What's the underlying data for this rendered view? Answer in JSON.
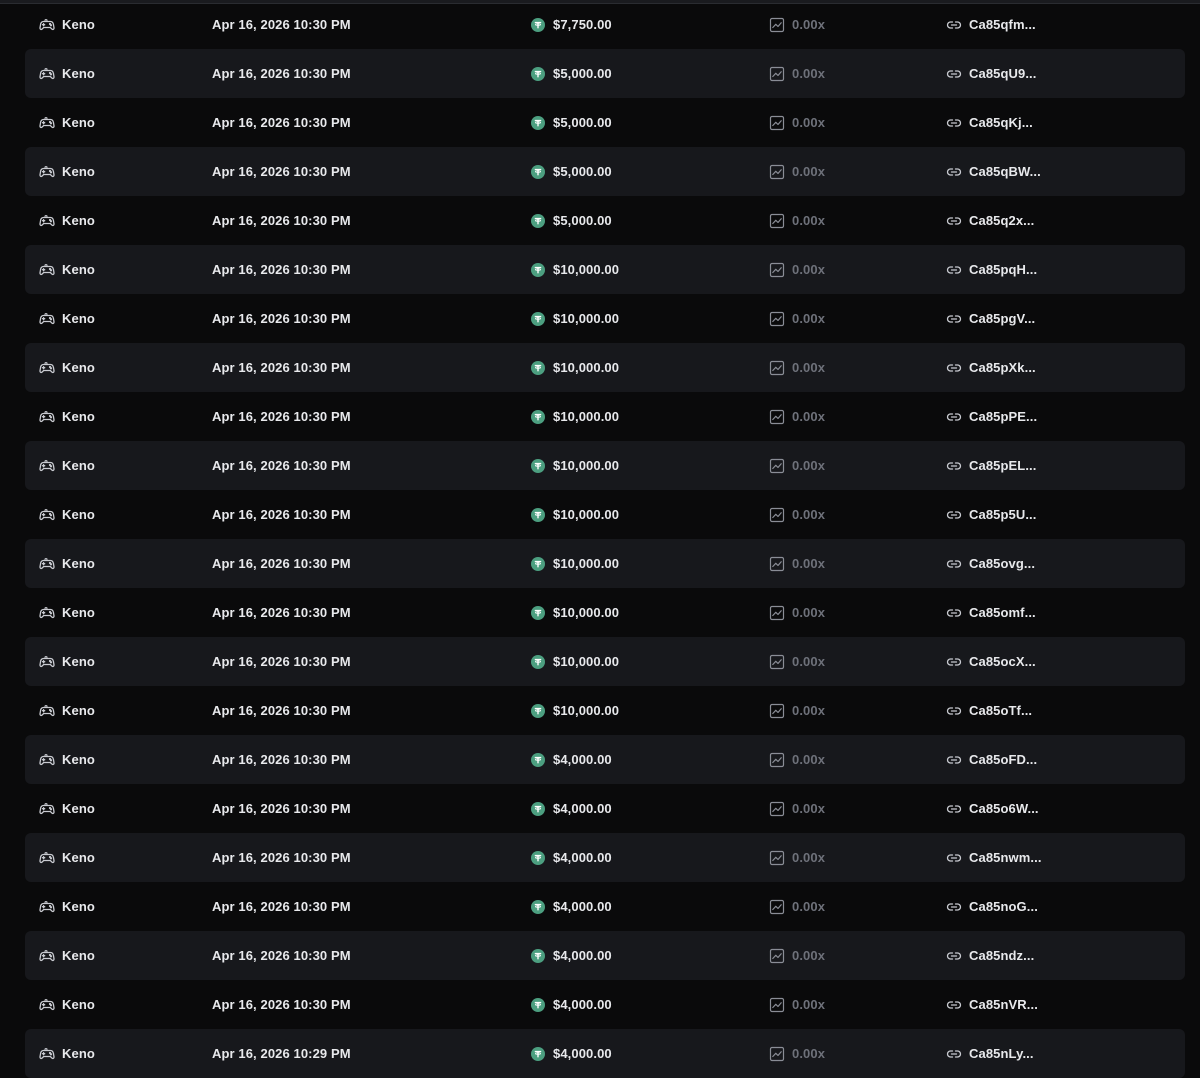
{
  "icons": {
    "game": "gamepad-icon",
    "currency": "tether-icon",
    "multiplier": "chart-icon",
    "tx": "link-icon"
  },
  "colors": {
    "background": "#0a0a0b",
    "row_alt": "#17181c",
    "tether": "#4c9f80",
    "muted": "#6e717a"
  },
  "rows": [
    {
      "game": "Keno",
      "date": "Apr 16, 2026 10:30 PM",
      "amount": "$7,750.00",
      "multiplier": "0.00x",
      "tx": "Ca85qfm..."
    },
    {
      "game": "Keno",
      "date": "Apr 16, 2026 10:30 PM",
      "amount": "$5,000.00",
      "multiplier": "0.00x",
      "tx": "Ca85qU9..."
    },
    {
      "game": "Keno",
      "date": "Apr 16, 2026 10:30 PM",
      "amount": "$5,000.00",
      "multiplier": "0.00x",
      "tx": "Ca85qKj..."
    },
    {
      "game": "Keno",
      "date": "Apr 16, 2026 10:30 PM",
      "amount": "$5,000.00",
      "multiplier": "0.00x",
      "tx": "Ca85qBW..."
    },
    {
      "game": "Keno",
      "date": "Apr 16, 2026 10:30 PM",
      "amount": "$5,000.00",
      "multiplier": "0.00x",
      "tx": "Ca85q2x..."
    },
    {
      "game": "Keno",
      "date": "Apr 16, 2026 10:30 PM",
      "amount": "$10,000.00",
      "multiplier": "0.00x",
      "tx": "Ca85pqH..."
    },
    {
      "game": "Keno",
      "date": "Apr 16, 2026 10:30 PM",
      "amount": "$10,000.00",
      "multiplier": "0.00x",
      "tx": "Ca85pgV..."
    },
    {
      "game": "Keno",
      "date": "Apr 16, 2026 10:30 PM",
      "amount": "$10,000.00",
      "multiplier": "0.00x",
      "tx": "Ca85pXk..."
    },
    {
      "game": "Keno",
      "date": "Apr 16, 2026 10:30 PM",
      "amount": "$10,000.00",
      "multiplier": "0.00x",
      "tx": "Ca85pPE..."
    },
    {
      "game": "Keno",
      "date": "Apr 16, 2026 10:30 PM",
      "amount": "$10,000.00",
      "multiplier": "0.00x",
      "tx": "Ca85pEL..."
    },
    {
      "game": "Keno",
      "date": "Apr 16, 2026 10:30 PM",
      "amount": "$10,000.00",
      "multiplier": "0.00x",
      "tx": "Ca85p5U..."
    },
    {
      "game": "Keno",
      "date": "Apr 16, 2026 10:30 PM",
      "amount": "$10,000.00",
      "multiplier": "0.00x",
      "tx": "Ca85ovg..."
    },
    {
      "game": "Keno",
      "date": "Apr 16, 2026 10:30 PM",
      "amount": "$10,000.00",
      "multiplier": "0.00x",
      "tx": "Ca85omf..."
    },
    {
      "game": "Keno",
      "date": "Apr 16, 2026 10:30 PM",
      "amount": "$10,000.00",
      "multiplier": "0.00x",
      "tx": "Ca85ocX..."
    },
    {
      "game": "Keno",
      "date": "Apr 16, 2026 10:30 PM",
      "amount": "$10,000.00",
      "multiplier": "0.00x",
      "tx": "Ca85oTf..."
    },
    {
      "game": "Keno",
      "date": "Apr 16, 2026 10:30 PM",
      "amount": "$4,000.00",
      "multiplier": "0.00x",
      "tx": "Ca85oFD..."
    },
    {
      "game": "Keno",
      "date": "Apr 16, 2026 10:30 PM",
      "amount": "$4,000.00",
      "multiplier": "0.00x",
      "tx": "Ca85o6W..."
    },
    {
      "game": "Keno",
      "date": "Apr 16, 2026 10:30 PM",
      "amount": "$4,000.00",
      "multiplier": "0.00x",
      "tx": "Ca85nwm..."
    },
    {
      "game": "Keno",
      "date": "Apr 16, 2026 10:30 PM",
      "amount": "$4,000.00",
      "multiplier": "0.00x",
      "tx": "Ca85noG..."
    },
    {
      "game": "Keno",
      "date": "Apr 16, 2026 10:30 PM",
      "amount": "$4,000.00",
      "multiplier": "0.00x",
      "tx": "Ca85ndz..."
    },
    {
      "game": "Keno",
      "date": "Apr 16, 2026 10:30 PM",
      "amount": "$4,000.00",
      "multiplier": "0.00x",
      "tx": "Ca85nVR..."
    },
    {
      "game": "Keno",
      "date": "Apr 16, 2026 10:29 PM",
      "amount": "$4,000.00",
      "multiplier": "0.00x",
      "tx": "Ca85nLy..."
    }
  ]
}
